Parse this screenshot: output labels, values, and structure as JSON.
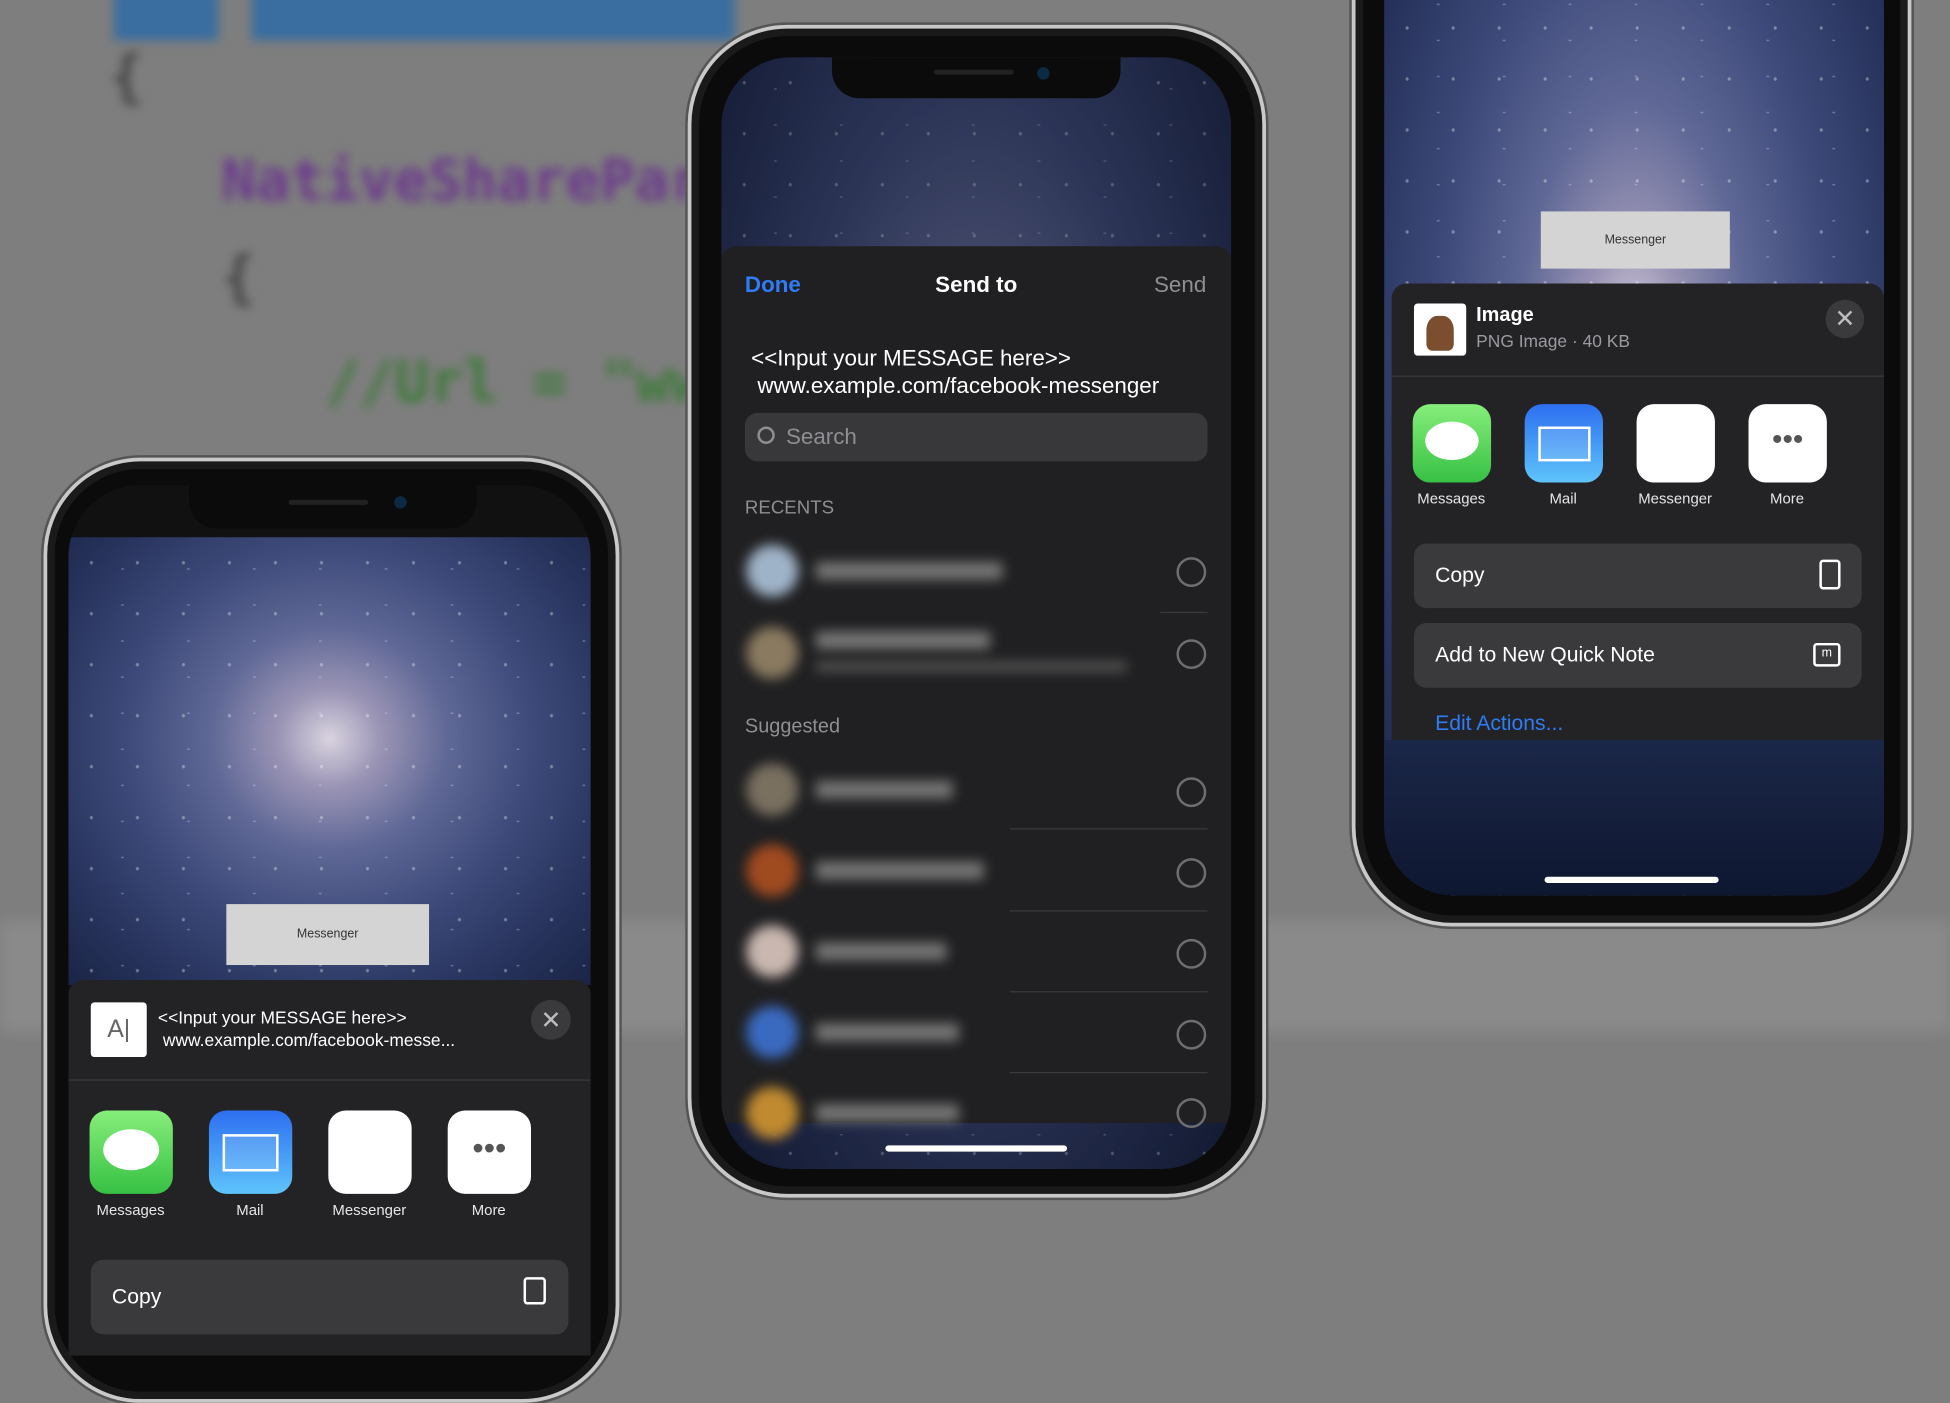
{
  "background_code": {
    "line1": "NativeShareParams",
    "line2": "{",
    "line3": "//Url = \"www.",
    "line4": "{"
  },
  "left_phone": {
    "overlay_button": "Messenger",
    "header": {
      "icon": "text-document-icon",
      "icon_text": "A|",
      "line1": "<<Input your MESSAGE here>>",
      "line2": "www.example.com/facebook-messe..."
    },
    "apps": [
      {
        "label": "Messages",
        "icon": "messages-icon"
      },
      {
        "label": "Mail",
        "icon": "mail-icon"
      },
      {
        "label": "Messenger",
        "icon": "messenger-icon"
      },
      {
        "label": "More",
        "icon": "more-icon"
      }
    ],
    "actions": [
      {
        "label": "Copy",
        "icon": "copy-icon"
      }
    ]
  },
  "middle_phone": {
    "header": {
      "done": "Done",
      "title": "Send to",
      "send": "Send"
    },
    "message_line1": "<<Input your MESSAGE here>>",
    "message_line2": "www.example.com/facebook-messenger",
    "search_placeholder": "Search",
    "recents_label": "RECENTS",
    "suggested_label": "Suggested",
    "accent": "#2f7cf6"
  },
  "right_phone": {
    "overlay_button": "Messenger",
    "header": {
      "title": "Image",
      "subtitle": "PNG Image · 40 KB"
    },
    "apps": [
      {
        "label": "Messages",
        "icon": "messages-icon"
      },
      {
        "label": "Mail",
        "icon": "mail-icon"
      },
      {
        "label": "Messenger",
        "icon": "messenger-icon"
      },
      {
        "label": "More",
        "icon": "more-icon"
      }
    ],
    "actions": [
      {
        "label": "Copy",
        "icon": "copy-icon"
      },
      {
        "label": "Add to New Quick Note",
        "icon": "quick-note-icon"
      }
    ],
    "edit_actions": "Edit Actions..."
  }
}
